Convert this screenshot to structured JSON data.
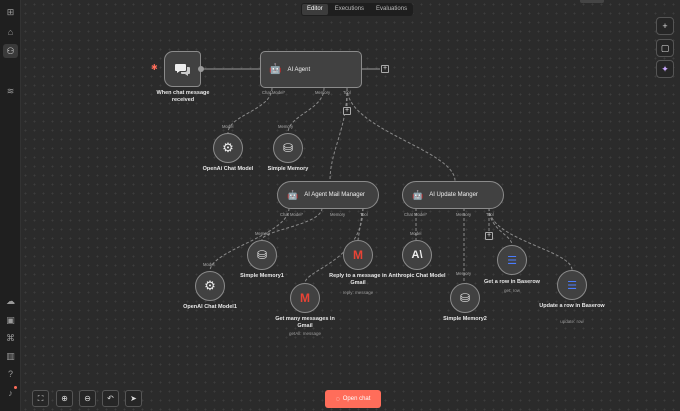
{
  "tabs": [
    "Editor",
    "Executions",
    "Evaluations"
  ],
  "nodes": {
    "chat_trigger": "When chat message received",
    "ai_agent": "AI Agent",
    "openai_chat_model": "OpenAi Chat Model",
    "simple_memory": "Simple Memory",
    "ai_agent_mail": "AI Agent Mail Manager",
    "ai_update": "AI Update Manger",
    "simple_memory1": "Simple Memory1",
    "openai_chat_model1": "OpenAI Chat Model1",
    "get_many_messages": "Get many messages in Gmail",
    "get_many_messages_sub": "getAll: message",
    "reply_gmail": "Reply to a message in Gmail",
    "reply_gmail_sub": "reply: message",
    "anthropic": "Anthropic Chat Model",
    "simple_memory2": "Simple Memory2",
    "get_row": "Get a row in Baserow",
    "get_row_sub": "get: row",
    "update_row": "Update a row in Baserow",
    "update_row_sub": "update: row"
  },
  "ports": {
    "chat_model": "Chat Model*",
    "memory": "Memory",
    "tool": "Tool",
    "model": "Model"
  },
  "open_chat_label": "Open chat",
  "colors": {
    "accent": "#ff6d5a",
    "node_fill": "#414141",
    "node_border": "#8b8b8b"
  }
}
